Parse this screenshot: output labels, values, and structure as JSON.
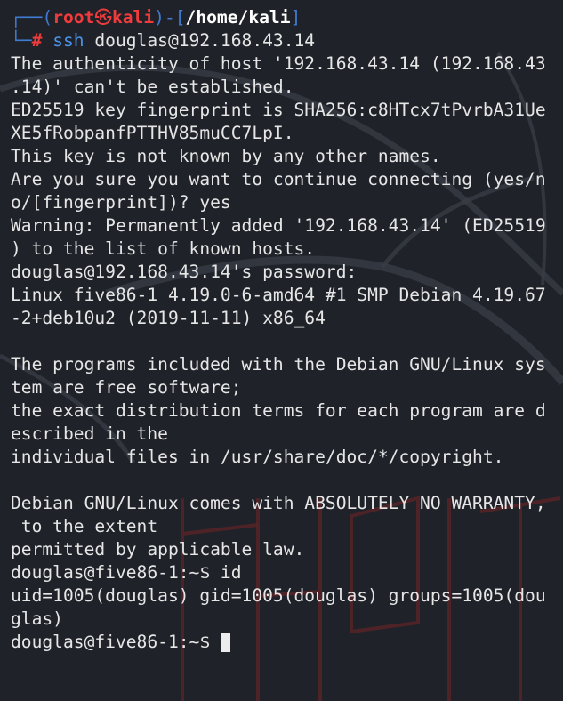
{
  "prompt": {
    "top_left": "┌──(",
    "user": "root",
    "skull": "㉿",
    "host": "kali",
    "mid": ")-[",
    "path": "/home/kali",
    "end": "]",
    "bottom_left": "└─",
    "hash": "#",
    "command": "ssh",
    "argument": " douglas@192.168.43.14"
  },
  "output_lines": [
    "The authenticity of host '192.168.43.14 (192.168.43",
    ".14)' can't be established.",
    "ED25519 key fingerprint is SHA256:c8HTcx7tPvrbA31Ue",
    "XE5fRobpanfPTTHV85muCC7LpI.",
    "This key is not known by any other names.",
    "Are you sure you want to continue connecting (yes/n",
    "o/[fingerprint])? yes",
    "Warning: Permanently added '192.168.43.14' (ED25519",
    ") to the list of known hosts.",
    "douglas@192.168.43.14's password:",
    "Linux five86-1 4.19.0-6-amd64 #1 SMP Debian 4.19.67",
    "-2+deb10u2 (2019-11-11) x86_64",
    "",
    "The programs included with the Debian GNU/Linux sys",
    "tem are free software;",
    "the exact distribution terms for each program are d",
    "escribed in the",
    "individual files in /usr/share/doc/*/copyright.",
    "",
    "Debian GNU/Linux comes with ABSOLUTELY NO WARRANTY,",
    " to the extent",
    "permitted by applicable law.",
    "douglas@five86-1:~$ id",
    "uid=1005(douglas) gid=1005(douglas) groups=1005(dou",
    "glas)"
  ],
  "final_prompt": "douglas@five86-1:~$ ",
  "colors": {
    "background": "#1f2229",
    "text": "#e6e6e6",
    "prompt_red": "#ef3b3b",
    "prompt_blue": "#3f7bd1",
    "command_blue": "#4a93e8"
  }
}
